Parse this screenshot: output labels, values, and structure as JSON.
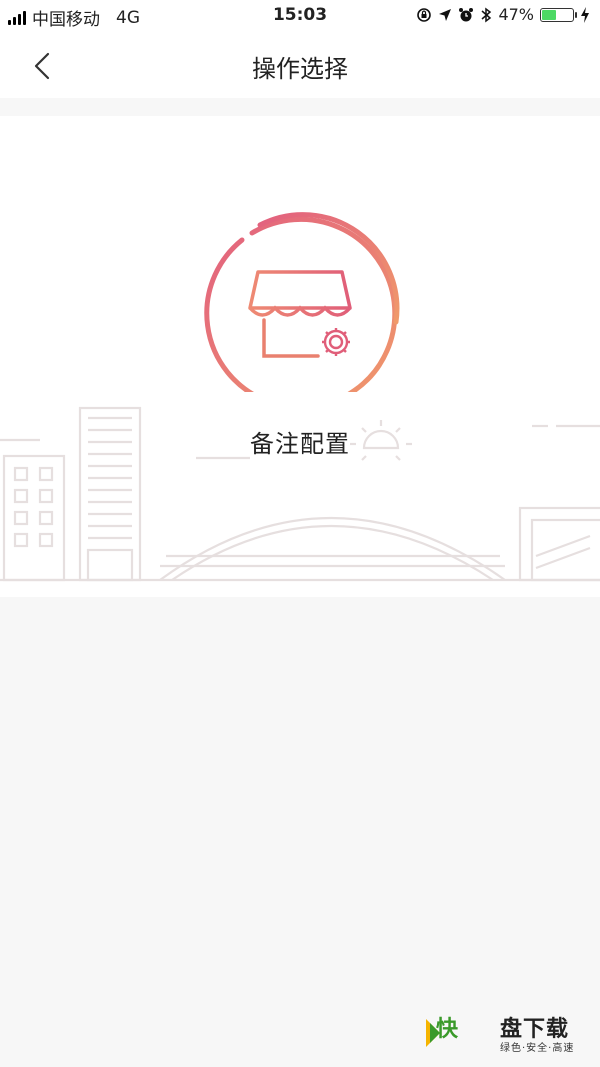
{
  "status_bar": {
    "carrier": "中国移动",
    "network": "4G",
    "time": "15:03",
    "battery_percent": "47%",
    "battery_level": 0.47,
    "battery_color": "#4cd964"
  },
  "nav": {
    "title": "操作选择",
    "back_icon": "chevron-left-icon"
  },
  "option": {
    "label": "备注配置",
    "icon": "store-settings-icon",
    "accent_colors": [
      "#e5677f",
      "#f0956a"
    ]
  },
  "watermark": {
    "brand_mark": "快",
    "brand_name": "盘下载",
    "slogan": "绿色·安全·高速"
  }
}
